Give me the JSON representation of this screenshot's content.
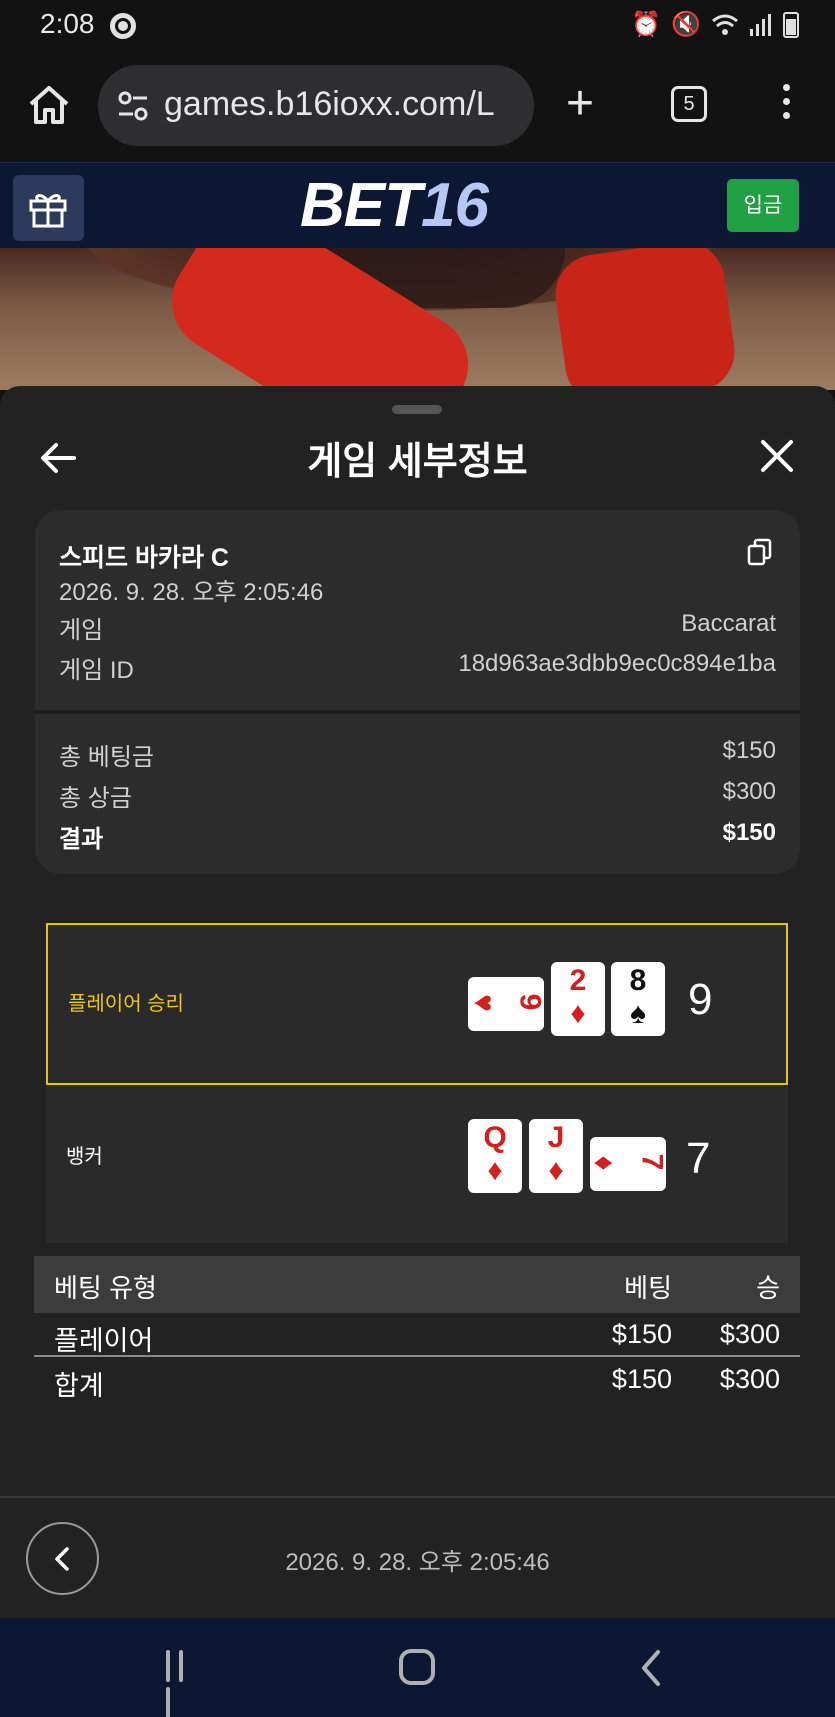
{
  "status_bar": {
    "time": "2:08"
  },
  "browser": {
    "url": "games.b16ioxx.com/L",
    "tab_count": "5"
  },
  "site": {
    "logo_part1": "BET",
    "logo_part2": "16",
    "deposit_label": "입금"
  },
  "sheet": {
    "title": "게임 세부정보",
    "game_name": "스피드 바카라 C",
    "game_datetime": "2026. 9. 28. 오후 2:05:46",
    "rows": [
      {
        "label": "게임",
        "value": "Baccarat"
      },
      {
        "label": "게임 ID",
        "value": "18d963ae3dbb9ec0c894e1ba"
      }
    ],
    "totals": [
      {
        "label": "총 베팅금",
        "value": "$150"
      },
      {
        "label": "총 상금",
        "value": "$300"
      },
      {
        "label": "결과",
        "value": "$150"
      }
    ]
  },
  "hands": {
    "player": {
      "label": "플레이어 승리",
      "score": "9",
      "cards": [
        {
          "rank": "9",
          "suit": "♥",
          "orientation": "horizontal",
          "color": "red"
        },
        {
          "rank": "2",
          "suit": "♦",
          "orientation": "vertical",
          "color": "red"
        },
        {
          "rank": "8",
          "suit": "♠",
          "orientation": "vertical",
          "color": "black"
        }
      ]
    },
    "banker": {
      "label": "뱅커",
      "score": "7",
      "cards": [
        {
          "rank": "Q",
          "suit": "♦",
          "orientation": "vertical",
          "color": "red"
        },
        {
          "rank": "J",
          "suit": "♦",
          "orientation": "vertical",
          "color": "red"
        },
        {
          "rank": "7",
          "suit": "♦",
          "orientation": "horizontal",
          "color": "red"
        }
      ]
    }
  },
  "bet_table": {
    "headers": {
      "type": "베팅 유형",
      "bet": "베팅",
      "win": "승"
    },
    "rows": [
      {
        "type": "플레이어",
        "bet": "$150",
        "win": "$300"
      }
    ],
    "total": {
      "type": "합계",
      "bet": "$150",
      "win": "$300"
    }
  },
  "footer": {
    "datetime": "2026. 9. 28. 오후 2:05:46"
  },
  "colors": {
    "accent_yellow": "#e8c21a",
    "deposit_green": "#1fa044",
    "header_navy": "#0b1733",
    "card_red": "#d4201c"
  },
  "icons": [
    "chrome-icon",
    "alarm-icon",
    "mute-icon",
    "wifi-icon",
    "signal-icon",
    "battery-icon",
    "home-icon",
    "site-settings-icon",
    "new-tab-icon",
    "tabs-icon",
    "more-icon",
    "gift-icon",
    "back-arrow-icon",
    "close-icon",
    "copy-icon",
    "chevron-left-icon"
  ]
}
